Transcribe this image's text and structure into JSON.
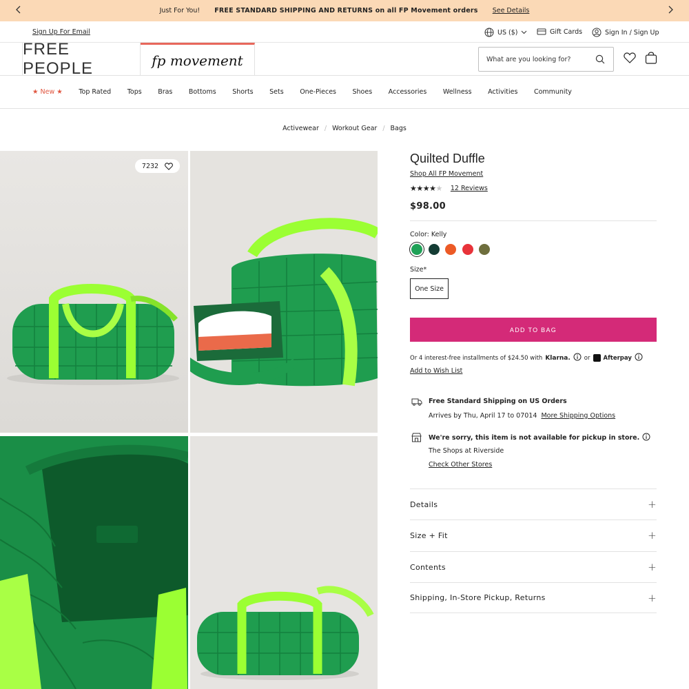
{
  "promo": {
    "prefix": "Just For You!",
    "headline": "FREE STANDARD SHIPPING AND RETURNS on all FP Movement orders",
    "link": "See Details"
  },
  "util": {
    "signup": "Sign Up For Email",
    "currency": "US ($)",
    "gift_cards": "Gift Cards",
    "sign_in": "Sign In / Sign Up"
  },
  "brand": {
    "free_people": "FREE PEOPLE",
    "fp_movement": "fp movement"
  },
  "search": {
    "placeholder": "What are you looking for?"
  },
  "nav": [
    "New",
    "Top Rated",
    "Tops",
    "Bras",
    "Bottoms",
    "Shorts",
    "Sets",
    "One-Pieces",
    "Shoes",
    "Accessories",
    "Wellness",
    "Activities",
    "Community"
  ],
  "breadcrumbs": [
    "Activewear",
    "Workout Gear",
    "Bags"
  ],
  "gallery": {
    "favorite_count": "7232"
  },
  "product": {
    "title": "Quilted Duffle",
    "shop_all": "Shop All FP Movement",
    "rating": 4,
    "rating_max": 5,
    "reviews": "12 Reviews",
    "price": "$98.00",
    "color_label": "Color: Kelly",
    "swatches": [
      "#1fa157",
      "#143c34",
      "#ec5a26",
      "#e8333a",
      "#6e6e3d"
    ],
    "size_label": "Size*",
    "size_value": "One Size",
    "add_to_bag": "ADD TO BAG",
    "installments_text": "Or 4 interest-free installments of $24.50 with",
    "klarna": "Klarna.",
    "or": "or",
    "afterpay": "Afterpay",
    "wishlist": "Add to Wish List"
  },
  "shipping": {
    "title": "Free Standard Shipping on US Orders",
    "arrives": "Arrives by Thu, April 17 to 07014",
    "more_options": "More Shipping Options"
  },
  "pickup": {
    "title": "We're sorry, this item is not available for pickup in store.",
    "store": "The Shops at Riverside",
    "check": "Check Other Stores"
  },
  "accordion": [
    "Details",
    "Size + Fit",
    "Contents",
    "Shipping, In-Store Pickup, Returns"
  ],
  "colors": {
    "accent": "#d42a78",
    "promo_bg": "#fbd9b6",
    "new_red": "#e0553f"
  }
}
